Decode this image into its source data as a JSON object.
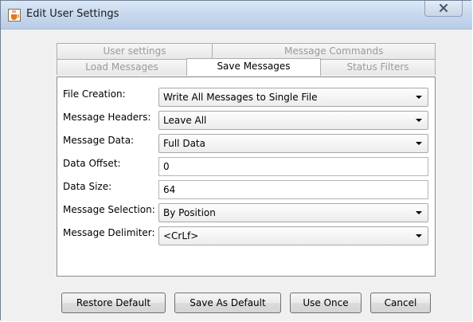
{
  "window": {
    "title": "Edit User Settings",
    "title_icon": "java-cup-icon",
    "close_icon": "close-icon"
  },
  "tabs": {
    "back_row": [
      {
        "label": "User settings",
        "selected": false
      },
      {
        "label": "Message Commands",
        "selected": false
      }
    ],
    "front_row": [
      {
        "label": "Load Messages",
        "selected": false
      },
      {
        "label": "Save Messages",
        "selected": true
      },
      {
        "label": "Status Filters",
        "selected": false
      }
    ]
  },
  "form": {
    "file_creation": {
      "label": "File Creation:",
      "value": "Write All Messages to Single File"
    },
    "message_headers": {
      "label": "Message Headers:",
      "value": "Leave All"
    },
    "message_data": {
      "label": "Message Data:",
      "value": "Full Data"
    },
    "data_offset": {
      "label": "Data Offset:",
      "value": "0"
    },
    "data_size": {
      "label": "Data Size:",
      "value": "64"
    },
    "message_selection": {
      "label": "Message Selection:",
      "value": "By Position"
    },
    "message_delimiter": {
      "label": "Message Delimiter:",
      "value": "<CrLf>"
    }
  },
  "buttons": {
    "restore_default": "Restore Default",
    "save_as_default": "Save As Default",
    "use_once": "Use Once",
    "cancel": "Cancel"
  }
}
